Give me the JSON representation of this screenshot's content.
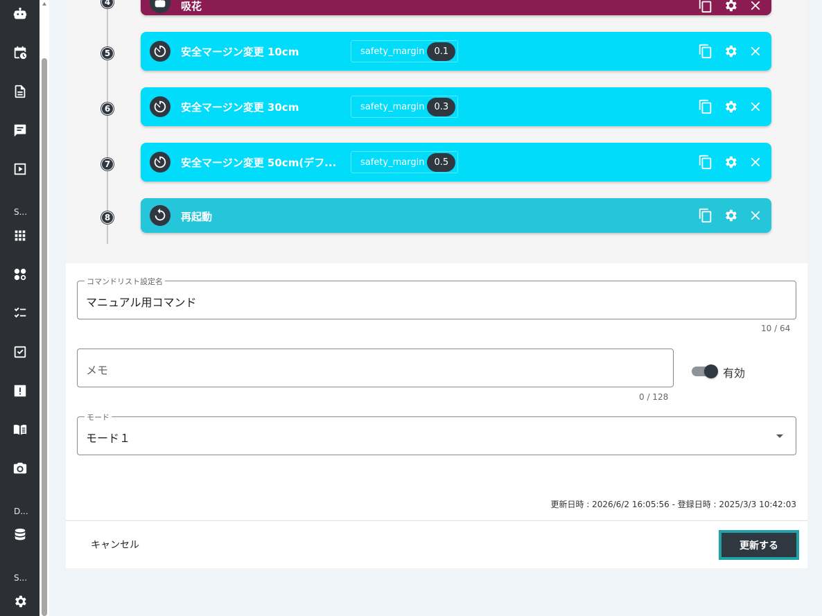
{
  "rail": {
    "section_1": "S...",
    "section_2": "D...",
    "section_3": "S..."
  },
  "steps": [
    {
      "num": "4",
      "title": "吸花",
      "color": "#8a1c52",
      "icon": "robot-icon",
      "param": null
    },
    {
      "num": "5",
      "title": "安全マージン変更 10cm",
      "color": "#00dcfa",
      "icon": "timer-icon",
      "param": {
        "name": "safety_margin",
        "value": "0.1"
      }
    },
    {
      "num": "6",
      "title": "安全マージン変更 30cm",
      "color": "#00dcfa",
      "icon": "timer-icon",
      "param": {
        "name": "safety_margin",
        "value": "0.3"
      }
    },
    {
      "num": "7",
      "title": "安全マージン変更 50cm(デフ...",
      "color": "#00dcfa",
      "icon": "timer-icon",
      "param": {
        "name": "safety_margin",
        "value": "0.5"
      }
    },
    {
      "num": "8",
      "title": "再起動",
      "color": "#26c6da",
      "icon": "restart-icon",
      "param": null
    }
  ],
  "form": {
    "name_label": "コマンドリスト設定名",
    "name_value": "マニュアル用コマンド",
    "name_counter": "10 / 64",
    "memo_placeholder": "メモ",
    "memo_counter": "0 / 128",
    "enabled_label": "有効",
    "enabled": true,
    "mode_label": "モード",
    "mode_value": "モード１",
    "timestamps": "更新日時 : 2026/6/2 16:05:56 - 登録日時 : 2025/3/3 10:42:03"
  },
  "actions": {
    "cancel": "キャンセル",
    "update": "更新する"
  }
}
